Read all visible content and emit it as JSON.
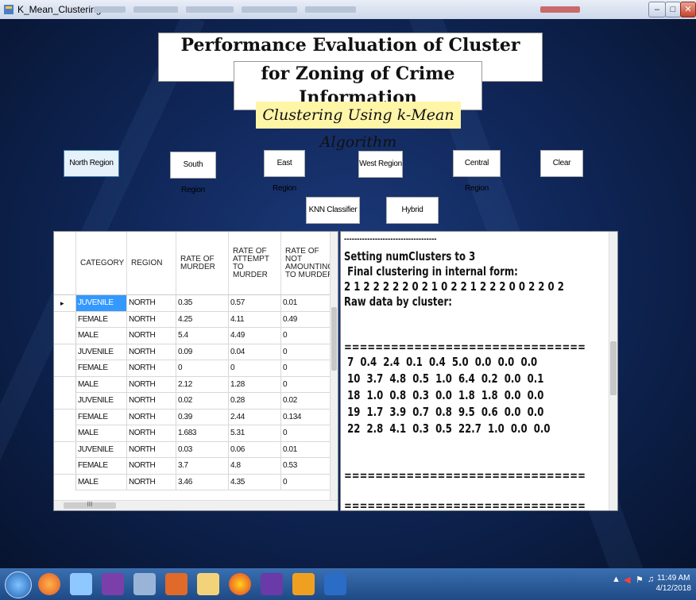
{
  "window": {
    "title": "K_Mean_Clustering"
  },
  "header": {
    "title_line1": "Performance Evaluation of Cluster based technique",
    "title_line2": "for Zoning of Crime Information",
    "subtitle": "Clustering Using k-Mean Algorithm"
  },
  "buttons": {
    "north": "North Region",
    "south": "South Region",
    "east": "East Region",
    "west": "West Region",
    "central": "Central Region",
    "clear": "Clear",
    "knn": "KNN Classifier",
    "hybrid": "Hybrid Classifier"
  },
  "table": {
    "columns": [
      "CATEGORY",
      "REGION",
      "RATE OF MURDER",
      "RATE OF ATTEMPT TO MURDER",
      "RATE OF NOT AMOUNTING TO MURDER"
    ],
    "rows": [
      [
        "JUVENILE",
        "NORTH",
        "0.35",
        "0.57",
        "0.01"
      ],
      [
        "FEMALE",
        "NORTH",
        "4.25",
        "4.11",
        "0.49"
      ],
      [
        "MALE",
        "NORTH",
        "5.4",
        "4.49",
        "0"
      ],
      [
        "JUVENILE",
        "NORTH",
        "0.09",
        "0.04",
        "0"
      ],
      [
        "FEMALE",
        "NORTH",
        "0",
        "0",
        "0"
      ],
      [
        "MALE",
        "NORTH",
        "2.12",
        "1.28",
        "0"
      ],
      [
        "JUVENILE",
        "NORTH",
        "0.02",
        "0.28",
        "0.02"
      ],
      [
        "FEMALE",
        "NORTH",
        "0.39",
        "2.44",
        "0.134"
      ],
      [
        "MALE",
        "NORTH",
        "1.683",
        "5.31",
        "0"
      ],
      [
        "JUVENILE",
        "NORTH",
        "0.03",
        "0.06",
        "0.01"
      ],
      [
        "FEMALE",
        "NORTH",
        "3.7",
        "4.8",
        "0.53"
      ],
      [
        "MALE",
        "NORTH",
        "3.46",
        "4.35",
        "0"
      ]
    ],
    "current_row_marker": "▸",
    "hscroll_label": "III"
  },
  "output": {
    "lines": [
      "------------------------------------",
      "Setting numClusters to 3",
      " Final clustering in internal form:",
      "2 1 2 2 2 2 2 0 2 1 0 2 2 1 2 2 2 0 0 2 2 0 2",
      "Raw data by cluster:",
      "",
      "",
      "===============================",
      " 7  0.4  2.4  0.1  0.4  5.0  0.0  0.0  0.0",
      " 10  3.7  4.8  0.5  1.0  6.4  0.2  0.0  0.1",
      " 18  1.0  0.8  0.3  0.0  1.8  1.8  0.0  0.0",
      " 19  1.7  3.9  0.7  0.8  9.5  0.6  0.0  0.0",
      " 22  2.8  4.1  0.3  0.5  22.7  1.0  0.0  0.0",
      "",
      "",
      "===============================",
      "",
      "",
      "==============================="
    ]
  },
  "taskbar": {
    "time": "11:49 AM",
    "date": "4/12/2018"
  },
  "colors": {
    "background": "#10275a",
    "subtitle_bg": "#fff5a6",
    "selection": "#3399ff",
    "taskbar": "#2a5d9e"
  }
}
